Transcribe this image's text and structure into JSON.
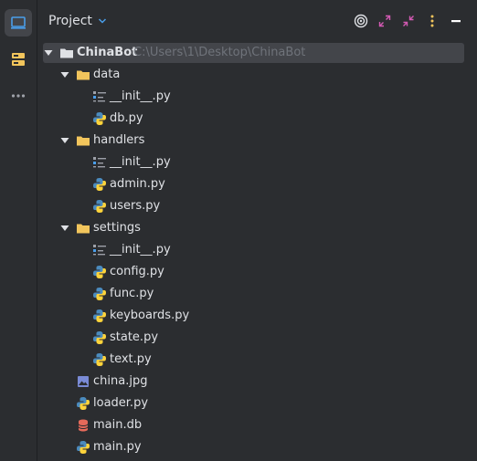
{
  "sidebar": {
    "items": [
      {
        "icon": "project-icon",
        "active": true
      },
      {
        "icon": "structure-icon",
        "active": false
      },
      {
        "icon": "more-icon",
        "active": false
      }
    ]
  },
  "panel": {
    "title": "Project",
    "actions": [
      "target-icon",
      "expand-icon",
      "collapse-icon",
      "options-icon",
      "minimize-icon"
    ]
  },
  "tree": {
    "root": {
      "name": "ChinaBot",
      "path": "C:\\Users\\1\\Desktop\\ChinaBot"
    },
    "items": [
      {
        "name": "data"
      },
      {
        "name": "__init__.py"
      },
      {
        "name": "db.py"
      },
      {
        "name": "handlers"
      },
      {
        "name": "__init__.py"
      },
      {
        "name": "admin.py"
      },
      {
        "name": "users.py"
      },
      {
        "name": "settings"
      },
      {
        "name": "__init__.py"
      },
      {
        "name": "config.py"
      },
      {
        "name": "func.py"
      },
      {
        "name": "keyboards.py"
      },
      {
        "name": "state.py"
      },
      {
        "name": "text.py"
      },
      {
        "name": "china.jpg"
      },
      {
        "name": "loader.py"
      },
      {
        "name": "main.db"
      },
      {
        "name": "main.py"
      }
    ]
  },
  "colors": {
    "background": "#2b2d30",
    "selection": "#43454a",
    "folder": "#f2c55c",
    "python_blue": "#4b8bbe",
    "python_yellow": "#ffd43b",
    "db": "#e66a5a",
    "image": "#7a8bd6",
    "accent": "#4a9eea"
  }
}
